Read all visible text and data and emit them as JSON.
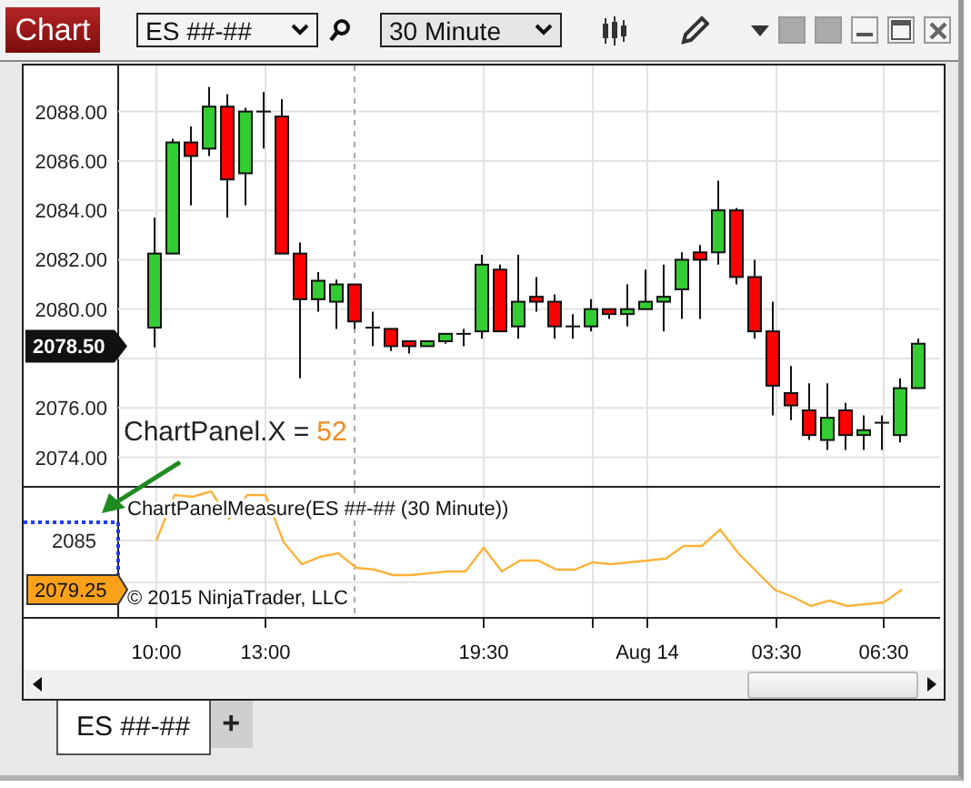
{
  "window": {
    "title": "Chart"
  },
  "toolbar": {
    "instrument": "ES ##-##",
    "interval": "30 Minute"
  },
  "price_panel": {
    "yticks": [
      "2088.00",
      "2086.00",
      "2084.00",
      "2082.00",
      "2080.00",
      "2076.00",
      "2074.00"
    ],
    "last_price": "2078.50",
    "annotation": {
      "label": "ChartPanel.X =",
      "value": "52"
    }
  },
  "indicator_panel": {
    "title": "ChartPanelMeasure(ES ##-## (30 Minute))",
    "copyright": "© 2015 NinjaTrader, LLC",
    "ytick": "2085",
    "last_value": "2079.25"
  },
  "time_axis": [
    "10:00",
    "13:00",
    "19:30",
    "Aug 14",
    "03:30",
    "06:30"
  ],
  "tabs": [
    {
      "label": "ES ##-##",
      "selected": true
    }
  ],
  "add_tab": "+"
}
